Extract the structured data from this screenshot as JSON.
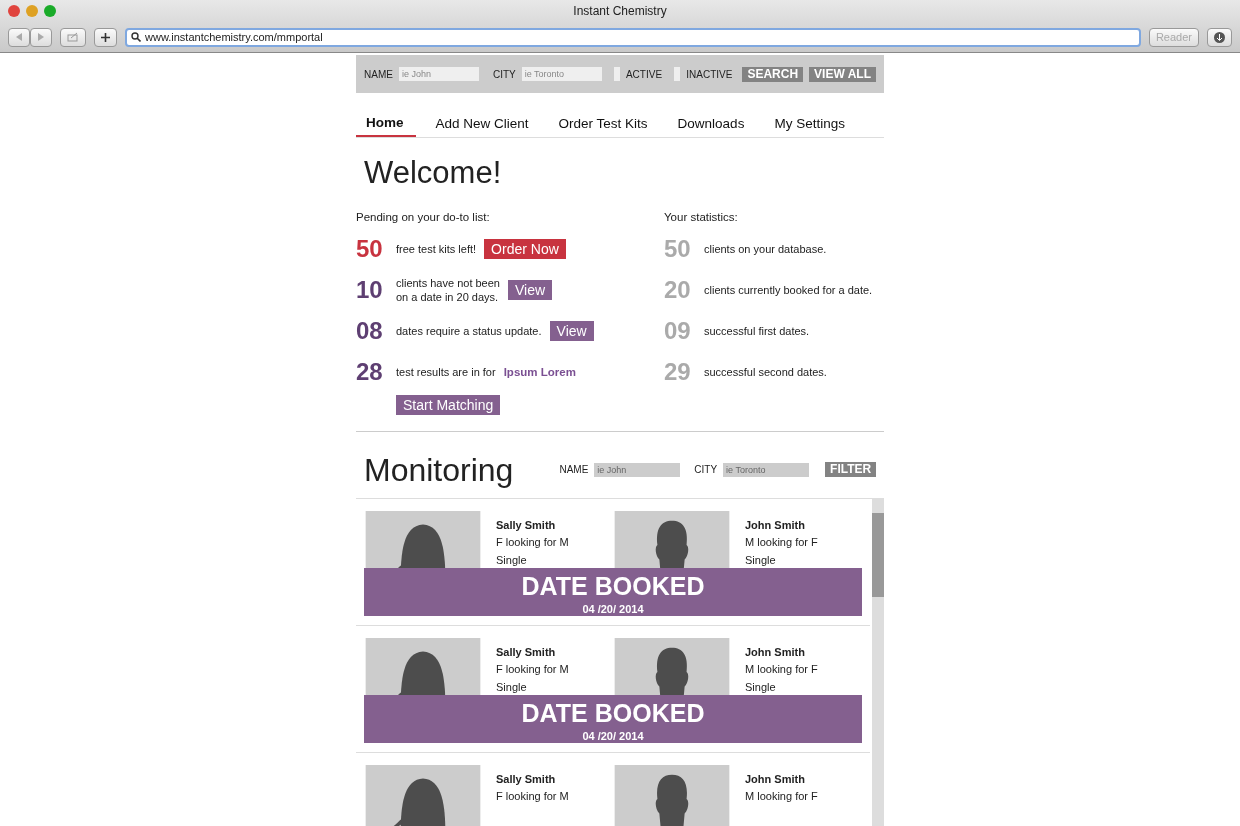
{
  "browser": {
    "title": "Instant Chemistry",
    "url": "www.instantchemistry.com/mmportal",
    "reader": "Reader"
  },
  "search_bar": {
    "fields": [
      {
        "label": "NAME",
        "placeholder": "ie John"
      },
      {
        "label": "CITY",
        "placeholder": "ie Toronto"
      }
    ],
    "checkboxes": [
      {
        "label": "ACTIVE",
        "checked": false
      },
      {
        "label": "INACTIVE",
        "checked": false
      }
    ],
    "buttons": [
      "SEARCH",
      "VIEW ALL"
    ]
  },
  "tabs": [
    {
      "label": "Home",
      "selected": true
    },
    {
      "label": "Add New Client",
      "selected": false
    },
    {
      "label": "Order Test Kits",
      "selected": false
    },
    {
      "label": "Downloads",
      "selected": false
    },
    {
      "label": "My Settings",
      "selected": false
    }
  ],
  "heading": "Welcome!",
  "pending": {
    "title": "Pending on your do-to list:",
    "items": [
      {
        "number": "50",
        "color": "#c8333f",
        "text": "free test kits left!",
        "button": "Order Now"
      },
      {
        "number": "10",
        "color": "#5e3f72",
        "text": "clients have not been\non a date in 20 days.",
        "button": "View"
      },
      {
        "number": "08",
        "color": "#5e3f72",
        "text": "dates require a status update.",
        "button": "View"
      },
      {
        "number": "28",
        "color": "#5e3f72",
        "text": "test results are in for",
        "link": "Ipsum Lorem",
        "button": "Start Matching"
      }
    ]
  },
  "statistics": {
    "title": "Your statistics:",
    "items": [
      {
        "number": "50",
        "text": "clients on your database."
      },
      {
        "number": "20",
        "text": "clients currently booked for a date."
      },
      {
        "number": "09",
        "text": "successful first dates."
      },
      {
        "number": "29",
        "text": "successful second dates."
      }
    ]
  },
  "monitoring": {
    "title": "Monitoring",
    "fields": [
      {
        "label": "NAME",
        "placeholder": "ie John"
      },
      {
        "label": "CITY",
        "placeholder": "ie Toronto"
      }
    ],
    "button": "FILTER",
    "matches": [
      {
        "people": [
          {
            "kind": "female",
            "name": "Sally Smith",
            "lines": [
              "F looking for M",
              "Single"
            ]
          },
          {
            "kind": "male",
            "name": "John Smith",
            "lines": [
              "M looking for F",
              "Single"
            ]
          }
        ],
        "status": {
          "title": "DATE BOOKED",
          "date": "04 /20/ 2014"
        }
      },
      {
        "people": [
          {
            "kind": "female",
            "name": "Sally Smith",
            "lines": [
              "F looking for M",
              "Single"
            ]
          },
          {
            "kind": "male",
            "name": "John Smith",
            "lines": [
              "M looking for F",
              "Single"
            ]
          }
        ],
        "status": {
          "title": "DATE BOOKED",
          "date": "04 /20/ 2014"
        }
      },
      {
        "people": [
          {
            "kind": "female",
            "name": "Sally Smith",
            "lines": [
              "F looking for M"
            ]
          },
          {
            "kind": "male",
            "name": "John Smith",
            "lines": [
              "M looking for F"
            ]
          }
        ]
      }
    ]
  }
}
